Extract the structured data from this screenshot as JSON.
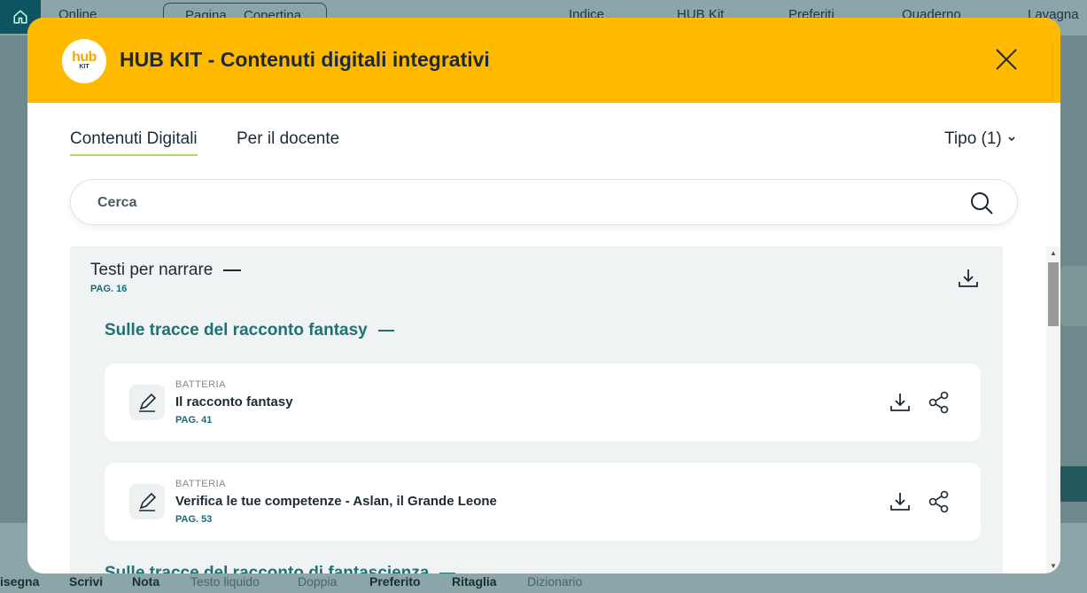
{
  "background": {
    "status": "Online",
    "breadcrumb": [
      "Pagina",
      "Copertina"
    ],
    "top_nav": [
      "Indice",
      "HUB Kit",
      "Preferiti",
      "Quaderno",
      "Lavagna"
    ],
    "bottom_tools": [
      "isegna",
      "Scrivi",
      "Nota",
      "Testo liquido",
      "Doppia",
      "Preferito",
      "Ritaglia",
      "Dizionario"
    ]
  },
  "modal": {
    "logo_text": "hub",
    "logo_sub": "KIT",
    "title": "HUB KIT - Contenuti digitali integrativi",
    "tabs": [
      {
        "label": "Contenuti Digitali",
        "active": true
      },
      {
        "label": "Per il docente",
        "active": false
      }
    ],
    "filter_label": "Tipo (1)",
    "search_placeholder": "Cerca",
    "section": {
      "title": "Testi per narrare",
      "page": "PAG. 16",
      "subsections": [
        {
          "title": "Sulle tracce del racconto fantasy",
          "items": [
            {
              "kind": "BATTERIA",
              "title": "Il racconto fantasy",
              "page": "PAG. 41",
              "icon": "pencil-icon"
            },
            {
              "kind": "BATTERIA",
              "title": "Verifica le tue competenze - Aslan, il Grande Leone",
              "page": "PAG. 53",
              "icon": "pencil-icon"
            }
          ]
        },
        {
          "title": "Sulle tracce del racconto di fantascienza",
          "items": []
        }
      ]
    }
  },
  "colors": {
    "header": "#ffba00",
    "accent_underline": "#b6d86a",
    "teal": "#217073"
  }
}
